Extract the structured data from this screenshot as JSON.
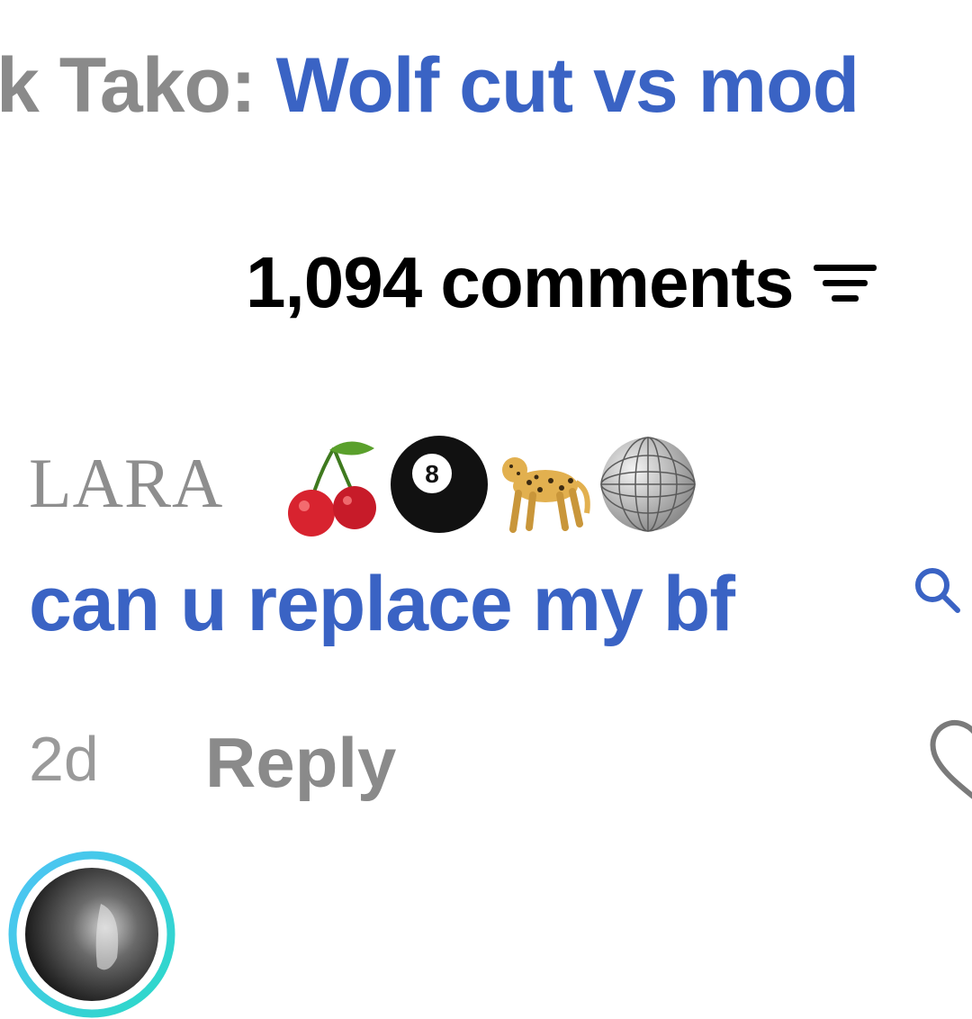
{
  "search_suggestion": {
    "prefix": "k Tako: ",
    "link_text": "Wolf cut vs mod"
  },
  "comments_header": {
    "count_label": "1,094 comments",
    "sort_icon": "sort-filter-icon"
  },
  "comment": {
    "username": "LARA",
    "username_emojis": [
      "cherries",
      "pool-8-ball",
      "leopard",
      "mirror-ball"
    ],
    "text": "can u replace my bf",
    "text_search_icon": "search-icon",
    "timestamp": "2d",
    "reply_label": "Reply",
    "like_icon": "heart-outline-icon"
  },
  "next_comment": {
    "avatar": "user-avatar"
  },
  "colors": {
    "link_blue": "#3a63c4",
    "muted_gray": "#8a8a8a",
    "story_ring_start": "#4fc3f7",
    "story_ring_end": "#2bd9c6"
  }
}
